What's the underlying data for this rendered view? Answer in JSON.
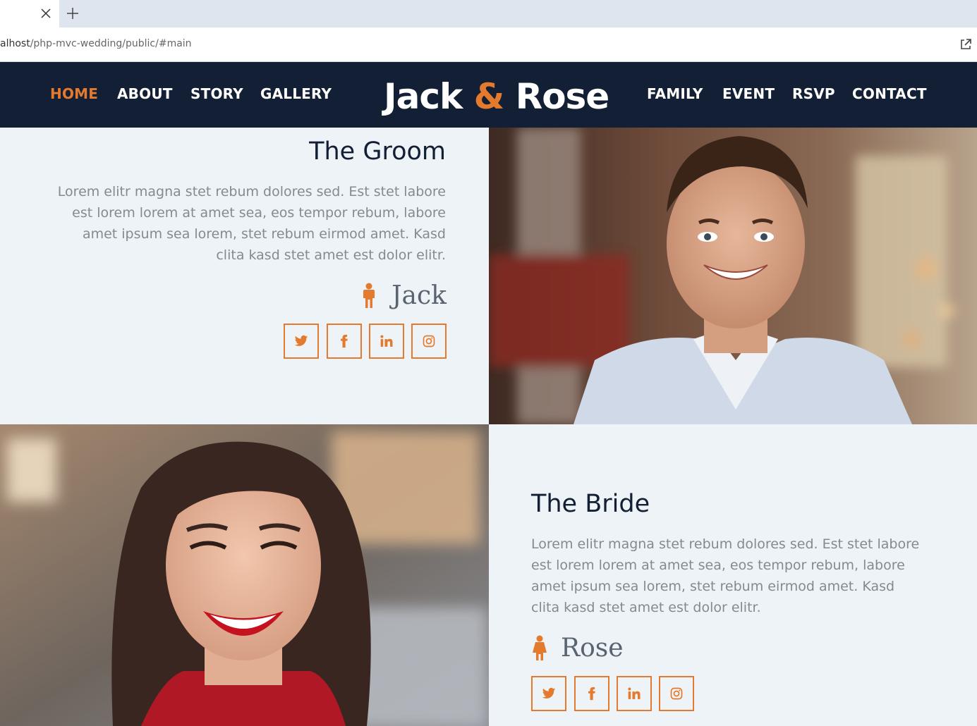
{
  "browser": {
    "url_host": "alhost",
    "url_path": "/php-mvc-wedding/public/#main",
    "close_tab_icon": "close-icon",
    "new_tab_icon": "plus-icon",
    "share_icon": "external-link-icon"
  },
  "nav": {
    "left_items": [
      "HOME",
      "ABOUT",
      "STORY",
      "GALLERY"
    ],
    "right_items": [
      "FAMILY",
      "EVENT",
      "RSVP",
      "CONTACT"
    ],
    "active": "HOME",
    "brand_first": "Jack",
    "brand_amp": "&",
    "brand_second": "Rose"
  },
  "groom": {
    "heading": "The Groom",
    "text": "Lorem elitr magna stet rebum dolores sed. Est stet labore est lorem lorem at amet sea, eos tempor rebum, labore amet ipsum sea lorem, stet rebum eirmod amet. Kasd clita kasd stet amet est dolor elitr.",
    "name": "Jack",
    "icon": "male-person-icon"
  },
  "bride": {
    "heading": "The Bride",
    "text": "Lorem elitr magna stet rebum dolores sed. Est stet labore est lorem lorem at amet sea, eos tempor rebum, labore amet ipsum sea lorem, stet rebum eirmod amet. Kasd clita kasd stet amet est dolor elitr.",
    "name": "Rose",
    "icon": "female-person-icon"
  },
  "social_icons": [
    "twitter-icon",
    "facebook-icon",
    "linkedin-icon",
    "instagram-icon"
  ],
  "colors": {
    "accent": "#e47a2e",
    "navbar_bg": "#121f35",
    "section_bg": "#edf3f6",
    "heading": "#121f35",
    "body_text": "#838a92"
  }
}
